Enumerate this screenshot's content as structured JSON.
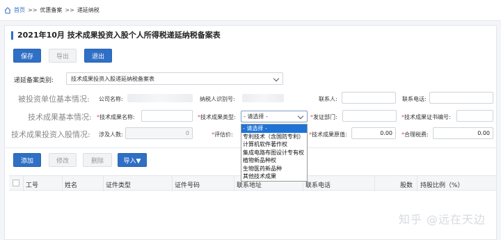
{
  "breadcrumb": {
    "home": "首页",
    "sep1": ">>",
    "level2": "优惠备案",
    "sep2": ">>",
    "current": "递延纳税"
  },
  "page": {
    "title": "2021年10月 技术成果投资入股个人所得税递延纳税备案表"
  },
  "toolbar": {
    "save": "保存",
    "export": "导出",
    "exit": "退出"
  },
  "category": {
    "label": "递延备案类别:",
    "selected": "技术成果投资入股递延纳税备案表"
  },
  "sections": {
    "unit": "被投资单位基本情况:",
    "tech": "技术成果基本情况:",
    "invest": "技术成果投资入股情况:"
  },
  "unit_fields": {
    "company_label": "公司名称:",
    "taxid_label": "纳税人识别号:",
    "contact_label": "联系人:",
    "phone_label": "联系电话:"
  },
  "tech_fields": {
    "req": "*",
    "name_label": "技术成果名称:",
    "type_label": "技术成果类型:",
    "type_value": "- 请选择 -",
    "dept_label": "发证部门:",
    "cert_label": "技术成果证书编号:"
  },
  "invest_fields": {
    "persons_label": "涉及人数:",
    "persons_value": "0",
    "price_label": "评估价:",
    "original_label": "技术成果原值:",
    "original_value": "0.00",
    "tax_label": "合理税费:",
    "tax_value": "0.00"
  },
  "type_options": [
    "- 请选择 -",
    "专利技术（含国防专利）",
    "计算机软件著作权",
    "集成电路布图设计专有权",
    "植物新品种权",
    "生物医药新品种",
    "其他技术成果"
  ],
  "table_toolbar": {
    "add": "添加",
    "edit": "修改",
    "delete": "删除",
    "import": "导入▼"
  },
  "table": {
    "headers": [
      "工号",
      "姓名",
      "证件类型",
      "证件号码",
      "联系地址",
      "联系电话",
      "股数",
      "持股比例（%）"
    ]
  },
  "watermark": "知乎 @远在天边",
  "colors": {
    "primary": "#2f6fc5",
    "required": "#e04b4b",
    "selected_option": "#1e73d8"
  }
}
